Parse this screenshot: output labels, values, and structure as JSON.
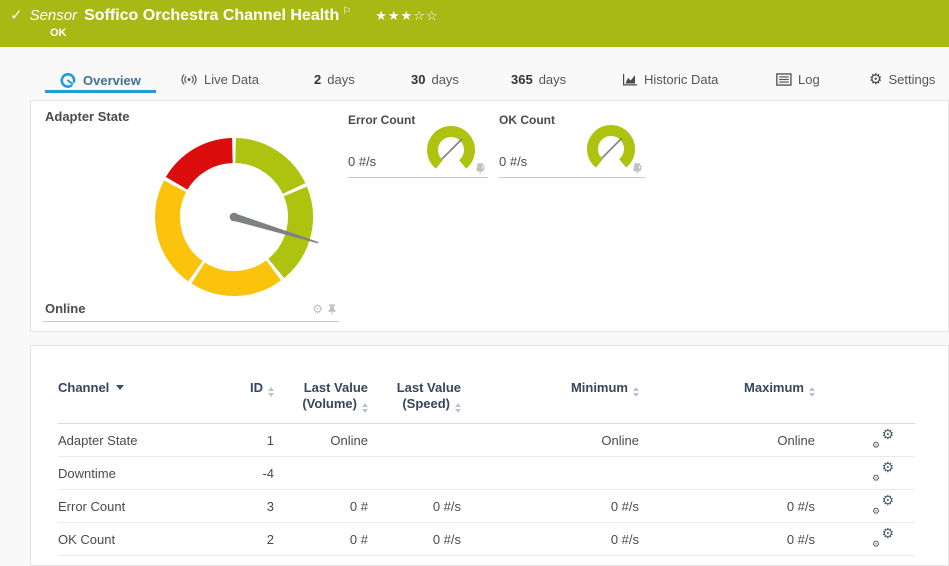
{
  "header": {
    "kind_label": "Sensor",
    "title": "Soffico Orchestra Channel Health",
    "status_text": "OK",
    "stars_filled": "★★★",
    "stars_empty": "☆☆",
    "rating": {
      "filled": 3,
      "total": 5
    }
  },
  "icons": {
    "check_glyph": "✓",
    "flag_glyph": "⚐",
    "gear_glyph": "⚙"
  },
  "colors": {
    "status_bar_green": "#a8b815",
    "accent_blue": "#1e9cd7",
    "gauge_green": "#aec30f",
    "gauge_yellow": "#fcc30d",
    "gauge_red": "#dc0d0d",
    "needle_gray": "#7d8084",
    "table_header_text": "#35465e"
  },
  "tabs": [
    {
      "label": "Overview",
      "active": true
    },
    {
      "label": "Live Data"
    },
    {
      "num": "2",
      "unit": "days"
    },
    {
      "num": "30",
      "unit": "days"
    },
    {
      "num": "365",
      "unit": "days"
    },
    {
      "label": "Historic Data"
    },
    {
      "label": "Log"
    },
    {
      "label": "Settings"
    }
  ],
  "gauges": {
    "adapter_state": {
      "title": "Adapter State",
      "value": "Online",
      "needle_angle_deg": 107,
      "needle_color": "#7d8084",
      "segments": [
        {
          "from": 0,
          "to": 66,
          "color": "#aec30f"
        },
        {
          "from": 66,
          "to": 142,
          "color": "#aec30f"
        },
        {
          "from": 142,
          "to": 214,
          "color": "#fcc30d"
        },
        {
          "from": 214,
          "to": 299,
          "color": "#fcc30d"
        },
        {
          "from": 299,
          "to": 360,
          "color": "#dc0d0d"
        }
      ]
    },
    "error_count": {
      "title": "Error Count",
      "value": "0 #/s",
      "arc_color": "#aec30f",
      "needle_angle_deg": 45
    },
    "ok_count": {
      "title": "OK Count",
      "value": "0 #/s",
      "arc_color": "#aec30f",
      "needle_angle_deg": 45
    }
  },
  "channel_table": {
    "columns": [
      {
        "label": "Channel",
        "sorted": "desc"
      },
      {
        "label": "ID"
      },
      {
        "label": "Last Value",
        "sublabel": "(Volume)"
      },
      {
        "label": "Last Value",
        "sublabel": "(Speed)"
      },
      {
        "label": "Minimum"
      },
      {
        "label": "Maximum"
      }
    ],
    "rows": [
      {
        "channel": "Adapter State",
        "id": "1",
        "last_value_volume": "Online",
        "last_value_speed": "",
        "minimum": "Online",
        "maximum": "Online"
      },
      {
        "channel": "Downtime",
        "id": "-4",
        "last_value_volume": "",
        "last_value_speed": "",
        "minimum": "",
        "maximum": ""
      },
      {
        "channel": "Error Count",
        "id": "3",
        "last_value_volume": "0 #",
        "last_value_speed": "0 #/s",
        "minimum": "0 #/s",
        "maximum": "0 #/s"
      },
      {
        "channel": "OK Count",
        "id": "2",
        "last_value_volume": "0 #",
        "last_value_speed": "0 #/s",
        "minimum": "0 #/s",
        "maximum": "0 #/s"
      }
    ]
  }
}
